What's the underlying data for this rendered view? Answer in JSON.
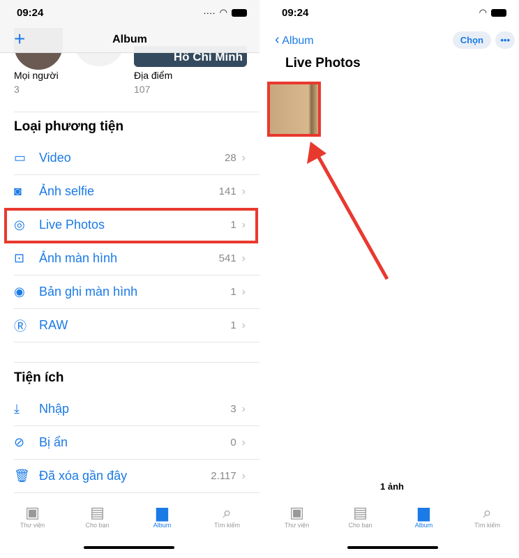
{
  "time": "09:24",
  "left": {
    "nav_title": "Album",
    "add_icon": "plus-icon",
    "top_items": [
      {
        "label": "Mọi người",
        "count": "3"
      },
      {
        "label": "Địa điểm",
        "count": "107",
        "map_label": "Hồ Chí Minh"
      }
    ],
    "media_section": "Loại phương tiện",
    "media_items": [
      {
        "icon": "video-icon",
        "label": "Video",
        "count": "28"
      },
      {
        "icon": "selfie-icon",
        "label": "Ảnh selfie",
        "count": "141"
      },
      {
        "icon": "live-photo-icon",
        "label": "Live Photos",
        "count": "1"
      },
      {
        "icon": "screenshot-icon",
        "label": "Ảnh màn hình",
        "count": "541"
      },
      {
        "icon": "screen-record-icon",
        "label": "Bản ghi màn hình",
        "count": "1"
      },
      {
        "icon": "raw-icon",
        "label": "RAW",
        "count": "1"
      }
    ],
    "utility_section": "Tiện ích",
    "utility_items": [
      {
        "icon": "import-icon",
        "label": "Nhập",
        "count": "3"
      },
      {
        "icon": "hidden-icon",
        "label": "Bị ẩn",
        "count": "0"
      },
      {
        "icon": "trash-icon",
        "label": "Đã xóa gần đây",
        "count": "2.117"
      }
    ]
  },
  "right": {
    "back_label": "Album",
    "select_label": "Chọn",
    "more_icon": "ellipsis-icon",
    "title": "Live Photos",
    "count_label": "1 ảnh"
  },
  "tabs": [
    {
      "label": "Thư viện",
      "icon": "photos-icon"
    },
    {
      "label": "Cho bạn",
      "icon": "for-you-icon"
    },
    {
      "label": "Album",
      "icon": "album-icon",
      "active": true
    },
    {
      "label": "Tìm kiếm",
      "icon": "search-icon"
    }
  ],
  "highlight_color": "#e8392f",
  "accent": "#1a7ae6"
}
